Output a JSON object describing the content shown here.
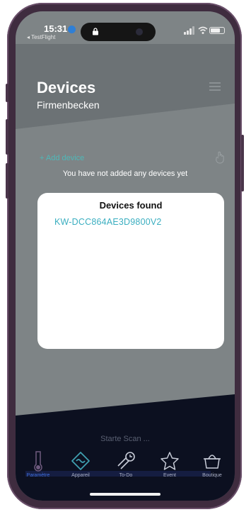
{
  "status_bar": {
    "time": "15:31",
    "back_app": "◂ TestFlight"
  },
  "header": {
    "title": "Devices",
    "subtitle": "Firmenbecken"
  },
  "main": {
    "add_device_label": "+ Add device",
    "empty_message": "You have not added any devices yet"
  },
  "modal": {
    "title": "Devices found",
    "devices": [
      "KW-DCC864AE3D9800V2"
    ]
  },
  "scan_status": "Starte Scan ...",
  "tabs": [
    {
      "label": "Paramètre",
      "icon": "thermometer-icon",
      "active": true
    },
    {
      "label": "Appareil",
      "icon": "device-icon",
      "active": false
    },
    {
      "label": "To-Do",
      "icon": "todo-icon",
      "active": false
    },
    {
      "label": "Event",
      "icon": "star-icon",
      "active": false
    },
    {
      "label": "Boutique",
      "icon": "shop-icon",
      "active": false
    }
  ],
  "colors": {
    "accent": "#4fb8b8",
    "device_text": "#3aaec0",
    "tab_active": "#3f6fe0",
    "bottom_bg": "#0c1020"
  }
}
